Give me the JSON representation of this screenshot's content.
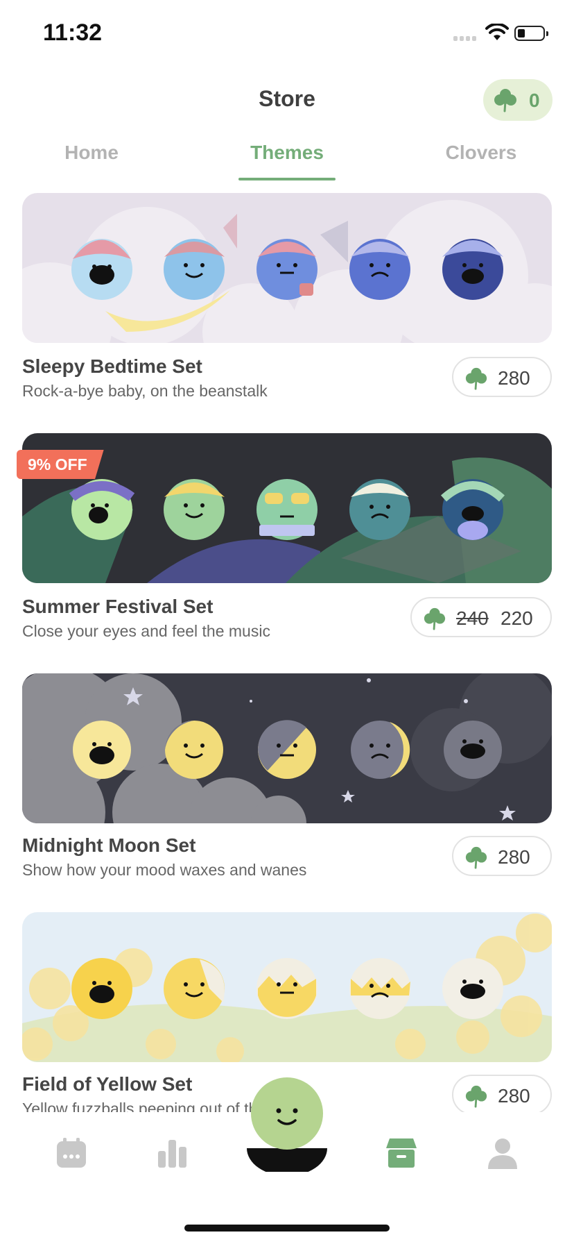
{
  "status_bar": {
    "time": "11:32"
  },
  "header": {
    "title": "Store",
    "clover_balance": "0"
  },
  "tabs": [
    {
      "label": "Home",
      "active": false
    },
    {
      "label": "Themes",
      "active": true
    },
    {
      "label": "Clovers",
      "active": false
    }
  ],
  "themes": [
    {
      "name": "Sleepy Bedtime Set",
      "description": "Rock-a-bye baby, on the beanstalk",
      "price": "280"
    },
    {
      "name": "Summer Festival Set",
      "description": "Close your eyes and feel the music",
      "original_price": "240",
      "price": "220",
      "badge": "9% OFF"
    },
    {
      "name": "Midnight Moon Set",
      "description": "Show how your mood waxes and wanes",
      "price": "280"
    },
    {
      "name": "Field of Yellow Set",
      "description": "Yellow fuzzballs peeping out of their shells",
      "price": "280"
    }
  ],
  "bottom_nav": [
    {
      "icon": "calendar-icon",
      "active": false
    },
    {
      "icon": "stats-icon",
      "active": false
    },
    {
      "icon": "add-mood-icon",
      "active": false
    },
    {
      "icon": "store-icon",
      "active": true
    },
    {
      "icon": "profile-icon",
      "active": false
    }
  ],
  "colors": {
    "accent": "#74ad79",
    "badge": "#f2705a",
    "inactive": "#c8c8c8"
  }
}
